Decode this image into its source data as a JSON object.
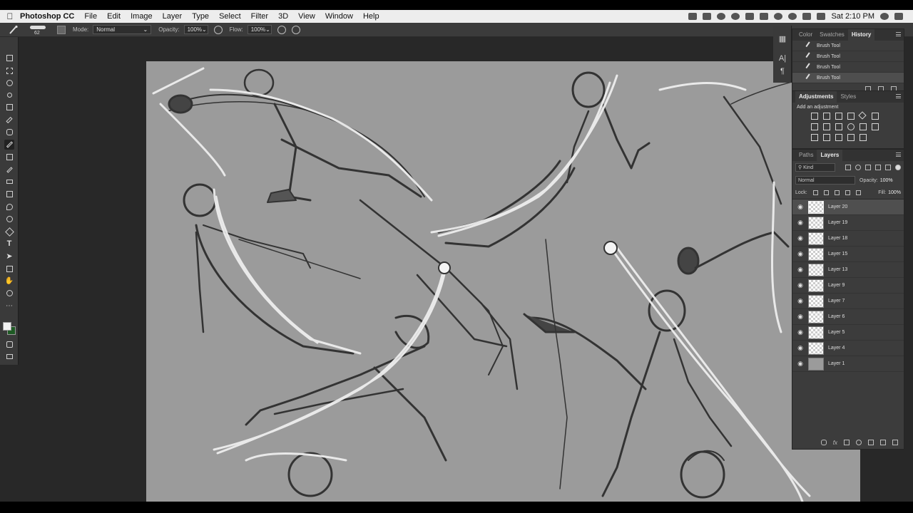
{
  "menubar": {
    "app_name": "Photoshop CC",
    "items": [
      "File",
      "Edit",
      "Image",
      "Layer",
      "Type",
      "Select",
      "Filter",
      "3D",
      "View",
      "Window",
      "Help"
    ],
    "clock": "Sat 2:10 PM",
    "icons": [
      "dropbox-icon",
      "battery-icon",
      "wifi-icon",
      "volume-icon",
      "search-icon",
      "list-icon"
    ]
  },
  "options": {
    "brush_size": "62",
    "mode_label": "Mode:",
    "mode_value": "Normal",
    "opacity_label": "Opacity:",
    "opacity_value": "100%",
    "flow_label": "Flow:",
    "flow_value": "100%"
  },
  "tools": [
    "move-tool-icon",
    "marquee-tool-icon",
    "lasso-tool-icon",
    "quick-select-tool-icon",
    "crop-tool-icon",
    "eyedropper-tool-icon",
    "healing-tool-icon",
    "brush-tool-icon",
    "stamp-tool-icon",
    "history-brush-icon",
    "eraser-tool-icon",
    "gradient-tool-icon",
    "blur-tool-icon",
    "dodge-tool-icon",
    "pen-tool-icon",
    "type-tool-icon",
    "path-select-tool-icon",
    "shape-tool-icon",
    "hand-tool-icon",
    "zoom-tool-icon",
    "more-tools-icon"
  ],
  "colors": {
    "foreground": "#f2f2f2",
    "background": "#1e5a24",
    "canvas": "#9b9b9b"
  },
  "history_panel": {
    "tabs": [
      "Color",
      "Swatches",
      "History"
    ],
    "active_tab": "History",
    "items": [
      "Brush Tool",
      "Brush Tool",
      "Brush Tool",
      "Brush Tool"
    ]
  },
  "adjustments_panel": {
    "tabs": [
      "Adjustments",
      "Styles"
    ],
    "active_tab": "Adjustments",
    "header": "Add an adjustment"
  },
  "layers_panel": {
    "tabs": [
      "Paths",
      "Layers"
    ],
    "active_tab": "Layers",
    "filter_kind": "Kind",
    "blend_mode": "Normal",
    "opacity_label": "Opacity:",
    "opacity_value": "100%",
    "lock_label": "Lock:",
    "fill_label": "Fill:",
    "fill_value": "100%",
    "layers": [
      "Layer 20",
      "Layer 19",
      "Layer 18",
      "Layer 15",
      "Layer 13",
      "Layer 9",
      "Layer 7",
      "Layer 6",
      "Layer 5",
      "Layer 4",
      "Layer 1"
    ],
    "selected": "Layer 20"
  }
}
